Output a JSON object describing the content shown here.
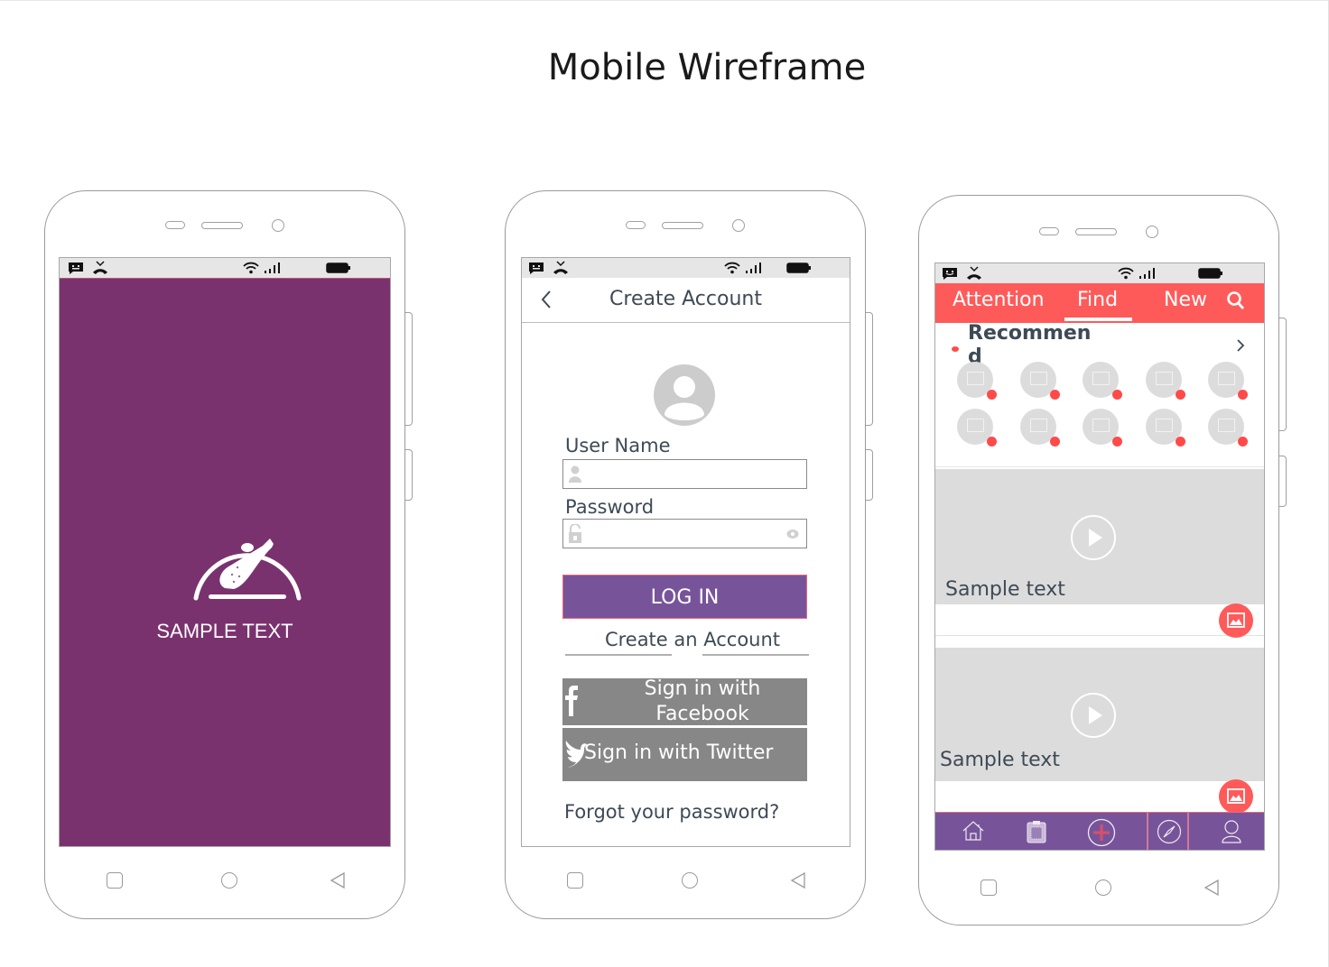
{
  "page": {
    "title": "Mobile Wireframe"
  },
  "status_icons": [
    "message-icon",
    "missed-call-icon",
    "wifi-icon",
    "signal-icon",
    "battery-icon"
  ],
  "nav_buttons": [
    "recent-apps-button",
    "home-button",
    "back-button"
  ],
  "phone1": {
    "splash_text": "SAMPLE TEXT",
    "icon": "food-cloche-drumstick-icon",
    "background_color": "#7a326e"
  },
  "phone2": {
    "header_title": "Create Account",
    "back_icon": "chevron-left-icon",
    "avatar_icon": "user-avatar-icon",
    "username_label": "User Name",
    "username_value": "",
    "password_label": "Password",
    "password_value": "",
    "login_button": "LOG IN",
    "create_account_link": "Create an Account",
    "facebook_button": "Sign in with Facebook",
    "twitter_button": "Sign in with Twitter",
    "forgot_password": "Forgot your password?",
    "accent_color": "#77549a"
  },
  "phone3": {
    "tabs": [
      {
        "label": "Attention",
        "active": false
      },
      {
        "label": "Find",
        "active": true
      },
      {
        "label": "New",
        "active": false
      }
    ],
    "search_icon": "search-icon",
    "section_title": "Recommend",
    "thumbnail_count": 10,
    "videos": [
      {
        "caption": "Sample text"
      },
      {
        "caption": "Sample text"
      }
    ],
    "bottom_nav": [
      "home-icon",
      "clipboard-icon",
      "add-icon",
      "compass-icon",
      "profile-icon"
    ],
    "accent_color": "#ff5a5a"
  }
}
